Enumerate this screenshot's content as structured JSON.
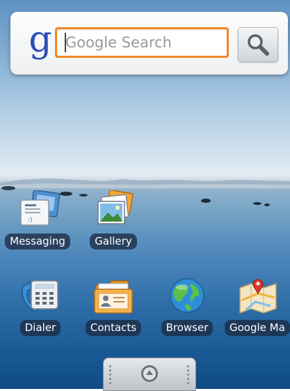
{
  "search": {
    "placeholder": "Google Search",
    "logo": "g"
  },
  "apps": [
    {
      "label": "Messaging",
      "icon": "messaging-icon"
    },
    {
      "label": "Gallery",
      "icon": "gallery-icon"
    },
    {
      "label": "Dialer",
      "icon": "phone-icon"
    },
    {
      "label": "Contacts",
      "icon": "contacts-icon"
    },
    {
      "label": "Browser",
      "icon": "globe-icon"
    },
    {
      "label": "Google Ma",
      "icon": "map-icon"
    }
  ],
  "drawer": {
    "icon": "app-drawer-arrow-icon"
  },
  "colors": {
    "search_border": "#f08a22",
    "logo": "#2b4fb8",
    "label_bg": "#1c2c42"
  }
}
